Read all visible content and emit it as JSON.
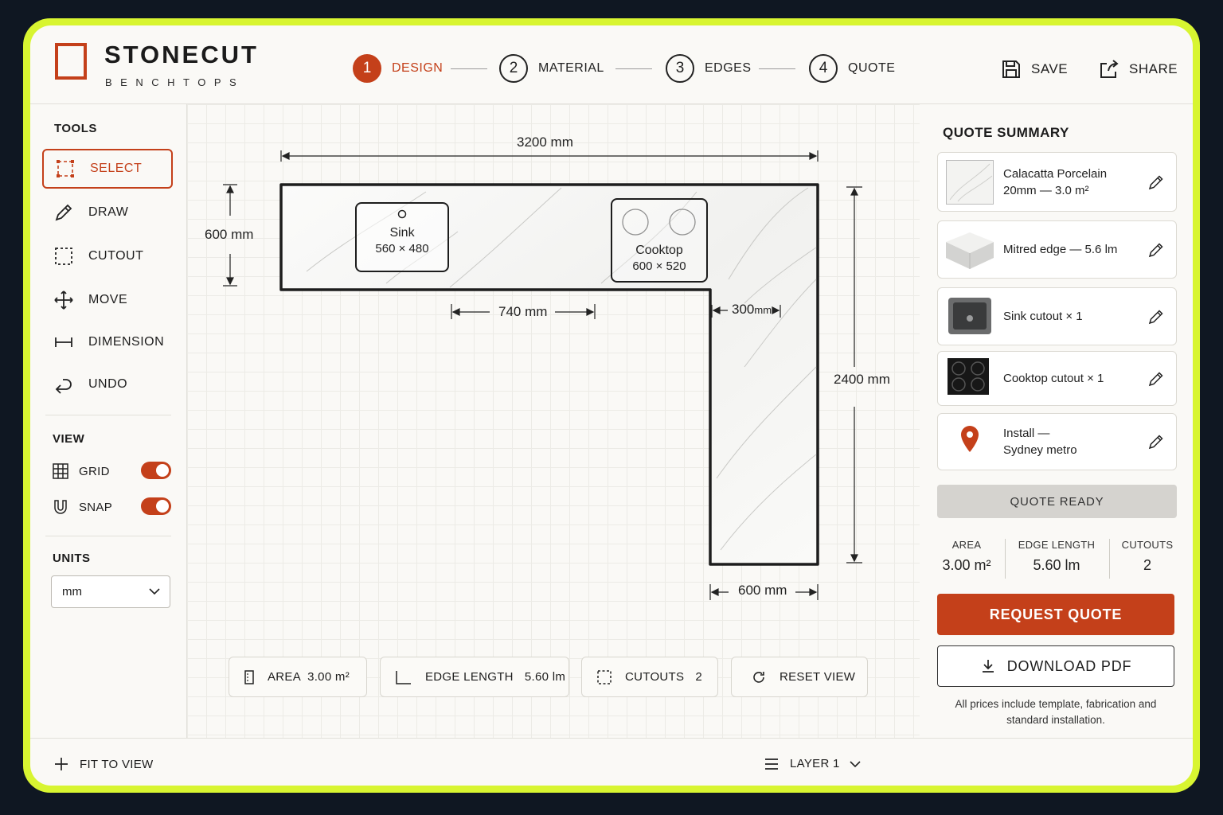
{
  "brand": {
    "name": "STONECUT",
    "subtitle": "BENCHTOPS"
  },
  "steps": [
    {
      "num": "1",
      "label": "DESIGN"
    },
    {
      "num": "2",
      "label": "MATERIAL"
    },
    {
      "num": "3",
      "label": "EDGES"
    },
    {
      "num": "4",
      "label": "QUOTE"
    }
  ],
  "header_actions": {
    "save": "SAVE",
    "share": "SHARE"
  },
  "sidebar": {
    "tools_title": "TOOLS",
    "tools": [
      "SELECT",
      "DRAW",
      "CUTOUT",
      "MOVE",
      "DIMENSION",
      "UNDO"
    ],
    "view_title": "VIEW",
    "view": {
      "grid": "GRID",
      "snap": "SNAP"
    },
    "units_title": "UNITS",
    "units_value": "mm"
  },
  "canvas": {
    "dims": {
      "top_width": "3200 mm",
      "left_depth": "600 mm",
      "inner_run": "740 mm",
      "inner_gap_value": "300",
      "inner_gap_unit": "mm",
      "right_height": "2400 mm",
      "bottom_width": "600 mm"
    },
    "sink": {
      "name": "Sink",
      "size": "560 × 480"
    },
    "cooktop": {
      "name": "Cooktop",
      "size": "600 × 520"
    },
    "pills": {
      "area_label": "AREA",
      "area_value": "3.00 m²",
      "edge_label": "EDGE LENGTH",
      "edge_value": "5.60 lm",
      "cutouts_label": "CUTOUTS",
      "cutouts_value": "2",
      "reset": "RESET VIEW"
    }
  },
  "quote": {
    "title": "QUOTE SUMMARY",
    "material_line1": "Calacatta Porcelain",
    "material_line2": "20mm — 3.0 m²",
    "edge": "Mitred edge — 5.6 lm",
    "sink": "Sink cutout × 1",
    "cooktop": "Cooktop cutout × 1",
    "install_line1": "Install —",
    "install_line2": "Sydney metro",
    "status": "QUOTE READY",
    "stats": [
      {
        "label": "AREA",
        "value": "3.00 m²"
      },
      {
        "label": "EDGE LENGTH",
        "value": "5.60 lm"
      },
      {
        "label": "CUTOUTS",
        "value": "2"
      }
    ],
    "request_button": "REQUEST QUOTE",
    "download_button": "DOWNLOAD PDF",
    "footnote": "All prices include template, fabrication and standard installation."
  },
  "footer": {
    "fit": "FIT TO VIEW",
    "layer": "LAYER 1"
  },
  "colors": {
    "accent": "#c4401a",
    "frame": "#d8f531",
    "background": "#0f1722",
    "panel": "#faf9f6"
  }
}
